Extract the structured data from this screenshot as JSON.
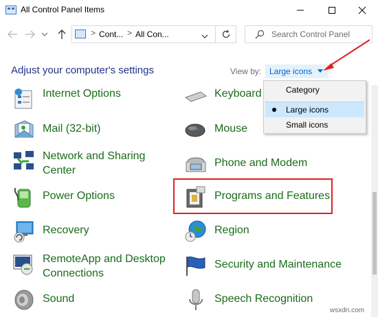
{
  "window": {
    "title": "All Control Panel Items",
    "minimize_glyph": "—",
    "maximize_glyph": "☐",
    "close_glyph": "✕"
  },
  "address": {
    "crumbs": [
      "Cont...",
      "All Con..."
    ],
    "separator": ">"
  },
  "search": {
    "placeholder": "Search Control Panel"
  },
  "header": {
    "title": "Adjust your computer's settings",
    "view_by_label": "View by:",
    "view_by_value": "Large icons"
  },
  "view_menu": {
    "items": [
      "Category",
      "Large icons",
      "Small icons"
    ],
    "selected": "Large icons"
  },
  "items": {
    "internet_options": "Internet Options",
    "keyboard": "Keyboard",
    "mail": "Mail (32-bit)",
    "mouse": "Mouse",
    "network_1": "Network and Sharing",
    "network_2": "Center",
    "phone_modem": "Phone and Modem",
    "power_options": "Power Options",
    "programs_features": "Programs and Features",
    "recovery": "Recovery",
    "region": "Region",
    "remoteapp_1": "RemoteApp and Desktop",
    "remoteapp_2": "Connections",
    "security": "Security and Maintenance",
    "sound": "Sound",
    "speech": "Speech Recognition"
  },
  "watermark": "wsxdn.com",
  "colors": {
    "link_green": "#1a6b1a",
    "heading_blue": "#1e3287",
    "highlight_red": "#e0201f",
    "menu_selected": "#cce8ff"
  }
}
